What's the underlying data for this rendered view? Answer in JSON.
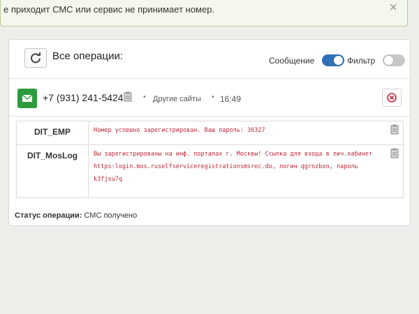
{
  "notice": {
    "text": "е приходит СМС или сервис не принимает номер.",
    "close_glyph": "×"
  },
  "operations": {
    "title": "Все операции:",
    "toggles": {
      "message_label": "Сообщение",
      "message_on": true,
      "filter_label": "Фильтр",
      "filter_on": false
    }
  },
  "operation": {
    "phone": "+7 (931) 241-5424",
    "separator": "•",
    "source": "Другие сайты",
    "time": "16:49",
    "messages": [
      {
        "sender": "DIT_EMP",
        "text": "Номер успешно зарегистрирован. Ваш пароль: 36327"
      },
      {
        "sender": "DIT_MosLog",
        "text": "Вы зарегистрированы на инф. порталах г. Москвы! Ссылка для входа в лич.кабинет https:login.mos.ruselfserviceregistrationsmsrec.do, логин qgrnzbxn, пароль k3fjxu7q"
      }
    ],
    "status_label": "Статус операции:",
    "status_value": "СМС получено"
  },
  "colors": {
    "accent": "#2f6fb4",
    "sms_green": "#2e9a3e",
    "message_red": "#c0283a",
    "close_red": "#c0283a"
  }
}
